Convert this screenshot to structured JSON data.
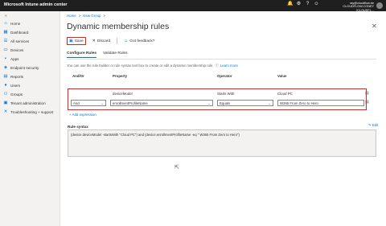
{
  "topbar": {
    "title": "Microsoft Intune admin center",
    "icons": [
      "notification-icon",
      "settings-icon",
      "help-icon",
      "feedback-icon"
    ],
    "account_line1": "ray@cloudflow.be",
    "account_line2": "CLOUDFLOW.CONEY (CLOUDFL..."
  },
  "sidebar": {
    "items": [
      {
        "label": "Home",
        "icon": "home-icon"
      },
      {
        "label": "Dashboard",
        "icon": "dashboard-icon"
      },
      {
        "label": "All services",
        "icon": "all-services-icon"
      },
      {
        "label": "Devices",
        "icon": "devices-icon"
      },
      {
        "label": "Apps",
        "icon": "apps-icon"
      },
      {
        "label": "Endpoint security",
        "icon": "endpoint-security-icon"
      },
      {
        "label": "Reports",
        "icon": "reports-icon"
      },
      {
        "label": "Users",
        "icon": "users-icon"
      },
      {
        "label": "Groups",
        "icon": "groups-icon"
      },
      {
        "label": "Tenant administration",
        "icon": "tenant-admin-icon"
      },
      {
        "label": "Troubleshooting + support",
        "icon": "troubleshooting-icon"
      }
    ]
  },
  "breadcrumb": {
    "home": "Home",
    "sep": ">",
    "current": "New Group",
    "sep2": ">"
  },
  "page": {
    "title": "Dynamic membership rules",
    "more": "···",
    "close": "✕"
  },
  "toolbar": {
    "save": "Save",
    "discard": "Discard",
    "feedback": "Got feedback?"
  },
  "tabs": {
    "configure": "Configure Rules",
    "validate": "Validate Rules"
  },
  "intro": {
    "text": "You can use the rule builder or rule syntax text box to create or edit a dynamic membership rule.",
    "learn_more": "Learn more"
  },
  "table": {
    "headers": {
      "and_or": "And/Or",
      "property": "Property",
      "operator": "Operator",
      "value": "Value"
    },
    "row1": {
      "property": "deviceModel",
      "operator": "Starts With",
      "value": "Cloud PC"
    },
    "row2": {
      "and_or": "And",
      "property": "enrollmentProfileName",
      "operator": "Equals",
      "value": "W365 From Zero to Hero"
    }
  },
  "add_expression": "+ Add expression",
  "syntax": {
    "title": "Rule syntax",
    "edit": "Edit",
    "text": "(device.deviceModel -startsWith \"Cloud PC\") and (device.enrollmentProfileName -eq \" W365 From Zero to Hero\")"
  },
  "colors": {
    "accent": "#0078d4",
    "highlight": "#e2231a",
    "topbar": "#1f1f1f"
  }
}
